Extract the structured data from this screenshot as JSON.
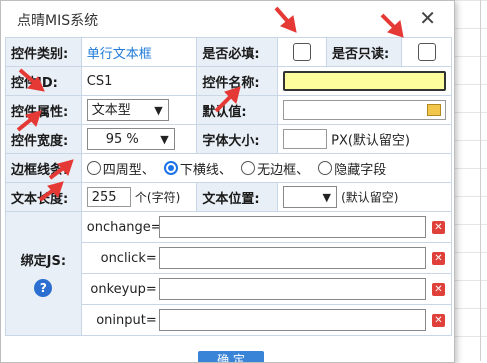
{
  "dialog": {
    "title": "点晴MIS系统",
    "close_icon": "close-icon"
  },
  "row1": {
    "type_label": "控件类别:",
    "type_value": "单行文本框",
    "required_label": "是否必填:",
    "readonly_label": "是否只读:"
  },
  "row2": {
    "id_label": "控件ID:",
    "id_value": "CS1",
    "name_label": "控件名称:",
    "name_value": ""
  },
  "row3": {
    "attr_label": "控件属性:",
    "attr_value": "文本型",
    "default_label": "默认值:",
    "default_value": ""
  },
  "row4": {
    "width_label": "控件宽度:",
    "width_value": "95 %",
    "fontsize_label": "字体大小:",
    "fontsize_value": "",
    "fontsize_unit": "PX(默认留空)"
  },
  "row5": {
    "border_label": "边框线条:",
    "options": [
      "四周型、",
      "下横线、",
      "无边框、",
      "隐藏字段"
    ],
    "selected_index": 1
  },
  "row6": {
    "length_label": "文本长度:",
    "length_value": "255",
    "length_unit": "个(字符)",
    "position_label": "文本位置:",
    "position_value": "",
    "position_hint": "(默认留空)"
  },
  "js": {
    "label": "绑定JS:",
    "events": [
      "onchange=",
      "onclick=",
      "onkeyup=",
      "oninput="
    ]
  },
  "footer": {
    "confirm_label": "确 定"
  },
  "colors": {
    "label_bg": "#e9eff6",
    "accent": "#1a73e8",
    "highlight_input": "#fdfd9e",
    "annotation_arrow": "#e53935"
  }
}
